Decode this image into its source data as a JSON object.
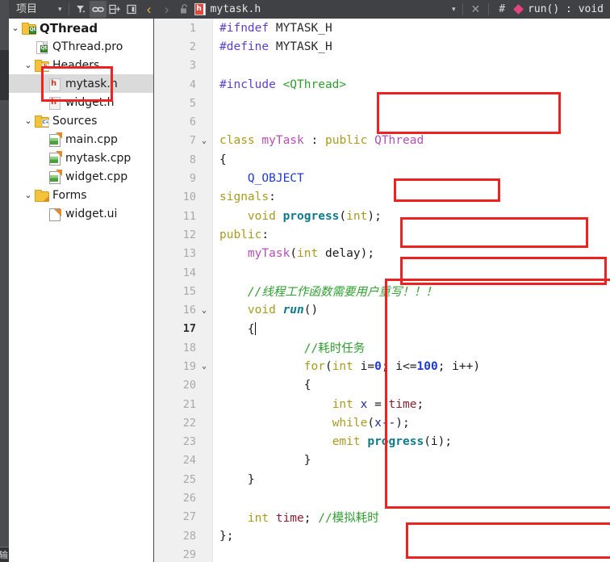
{
  "toolbar": {
    "project_label": "项目",
    "dropdown_caret": "▾",
    "filter_icon": "filter-icon",
    "link_icon": "link-icon",
    "split_icon": "split-add-icon",
    "panel_icon": "panel-icon",
    "nav_back": "‹",
    "nav_forward": "›",
    "lock_icon": "unlock-icon",
    "file_badge": "h",
    "filename": "mytask.h",
    "tab_caret": "▾",
    "close_label": "✕",
    "hash_label": "#",
    "symbol_label": "run() : void"
  },
  "rail": {
    "bottom_label": "输"
  },
  "sidebar": {
    "tree": [
      {
        "label": "QThread",
        "indent": 0,
        "chevron": "⌄",
        "icon": "folder-qt-icon",
        "bold": true,
        "selected": false
      },
      {
        "label": "QThread.pro",
        "indent": 1,
        "chevron": "",
        "icon": "doc-qt-icon",
        "bold": false,
        "selected": false
      },
      {
        "label": "Headers",
        "indent": 1,
        "chevron": "⌄",
        "icon": "folder-h-icon",
        "bold": false,
        "selected": false
      },
      {
        "label": "mytask.h",
        "indent": 2,
        "chevron": "",
        "icon": "h-file-icon",
        "bold": false,
        "selected": true
      },
      {
        "label": "widget.h",
        "indent": 2,
        "chevron": "",
        "icon": "h-file-icon",
        "bold": false,
        "selected": false
      },
      {
        "label": "Sources",
        "indent": 1,
        "chevron": "⌄",
        "icon": "folder-cpp-icon",
        "bold": false,
        "selected": false
      },
      {
        "label": "main.cpp",
        "indent": 2,
        "chevron": "",
        "icon": "cpp-file-icon",
        "bold": false,
        "selected": false
      },
      {
        "label": "mytask.cpp",
        "indent": 2,
        "chevron": "",
        "icon": "cpp-file-icon",
        "bold": false,
        "selected": false
      },
      {
        "label": "widget.cpp",
        "indent": 2,
        "chevron": "",
        "icon": "cpp-file-icon",
        "bold": false,
        "selected": false
      },
      {
        "label": "Forms",
        "indent": 1,
        "chevron": "⌄",
        "icon": "folder-ui-icon",
        "bold": false,
        "selected": false
      },
      {
        "label": "widget.ui",
        "indent": 2,
        "chevron": "",
        "icon": "ui-file-icon",
        "bold": false,
        "selected": false
      }
    ]
  },
  "editor": {
    "current_line": 17,
    "lines": [
      {
        "n": "1",
        "fold": "",
        "tokens": [
          {
            "t": "#ifndef ",
            "c": "t-pre"
          },
          {
            "t": "MYTASK_H",
            "c": "t-macro"
          }
        ]
      },
      {
        "n": "2",
        "fold": "",
        "tokens": [
          {
            "t": "#define ",
            "c": "t-pre"
          },
          {
            "t": "MYTASK_H",
            "c": "t-macro"
          }
        ]
      },
      {
        "n": "3",
        "fold": "",
        "tokens": []
      },
      {
        "n": "4",
        "fold": "",
        "tokens": [
          {
            "t": "#include ",
            "c": "t-pre"
          },
          {
            "t": "<QThread>",
            "c": "t-str"
          }
        ]
      },
      {
        "n": "5",
        "fold": "",
        "tokens": []
      },
      {
        "n": "6",
        "fold": "",
        "tokens": []
      },
      {
        "n": "7",
        "fold": "⌄",
        "tokens": [
          {
            "t": "class ",
            "c": "t-kw"
          },
          {
            "t": "myTask",
            "c": "t-type"
          },
          {
            "t": " : ",
            "c": "t-plain"
          },
          {
            "t": "public ",
            "c": "t-kw"
          },
          {
            "t": "QThread",
            "c": "t-type"
          }
        ]
      },
      {
        "n": "8",
        "fold": "",
        "tokens": [
          {
            "t": "{",
            "c": "t-plain"
          }
        ]
      },
      {
        "n": "9",
        "fold": "",
        "tokens": [
          {
            "t": "    ",
            "c": "t-plain"
          },
          {
            "t": "Q_OBJECT",
            "c": "t-obj"
          }
        ]
      },
      {
        "n": "10",
        "fold": "",
        "tokens": [
          {
            "t": "signals",
            "c": "t-kw"
          },
          {
            "t": ":",
            "c": "t-plain"
          }
        ]
      },
      {
        "n": "11",
        "fold": "",
        "tokens": [
          {
            "t": "    ",
            "c": "t-plain"
          },
          {
            "t": "void ",
            "c": "t-kw"
          },
          {
            "t": "progress",
            "c": "t-fn"
          },
          {
            "t": "(",
            "c": "t-plain"
          },
          {
            "t": "int",
            "c": "t-kw"
          },
          {
            "t": ");",
            "c": "t-plain"
          }
        ]
      },
      {
        "n": "12",
        "fold": "",
        "tokens": [
          {
            "t": "public",
            "c": "t-kw"
          },
          {
            "t": ":",
            "c": "t-plain"
          }
        ]
      },
      {
        "n": "13",
        "fold": "",
        "tokens": [
          {
            "t": "    ",
            "c": "t-plain"
          },
          {
            "t": "myTask",
            "c": "t-type"
          },
          {
            "t": "(",
            "c": "t-plain"
          },
          {
            "t": "int ",
            "c": "t-kw"
          },
          {
            "t": "delay",
            "c": "t-plain"
          },
          {
            "t": ");",
            "c": "t-plain"
          }
        ]
      },
      {
        "n": "14",
        "fold": "",
        "tokens": []
      },
      {
        "n": "15",
        "fold": "",
        "tokens": [
          {
            "t": "    ",
            "c": "t-plain"
          },
          {
            "t": "//线程工作函数需要用户重写！！！",
            "c": "t-cmt"
          }
        ]
      },
      {
        "n": "16",
        "fold": "⌄",
        "tokens": [
          {
            "t": "    ",
            "c": "t-plain"
          },
          {
            "t": "void ",
            "c": "t-kw"
          },
          {
            "t": "run",
            "c": "t-fni"
          },
          {
            "t": "()",
            "c": "t-plain"
          }
        ]
      },
      {
        "n": "17",
        "fold": "",
        "tokens": [
          {
            "t": "    ",
            "c": "t-plain"
          },
          {
            "t": "{",
            "c": "t-plain"
          }
        ],
        "caret": true
      },
      {
        "n": "18",
        "fold": "",
        "tokens": [
          {
            "t": "            ",
            "c": "t-plain"
          },
          {
            "t": "//耗时任务",
            "c": "t-cmt2"
          }
        ]
      },
      {
        "n": "19",
        "fold": "⌄",
        "tokens": [
          {
            "t": "            ",
            "c": "t-plain"
          },
          {
            "t": "for",
            "c": "t-kw"
          },
          {
            "t": "(",
            "c": "t-plain"
          },
          {
            "t": "int ",
            "c": "t-kw"
          },
          {
            "t": "i",
            "c": "t-plain"
          },
          {
            "t": "=",
            "c": "t-plain"
          },
          {
            "t": "0",
            "c": "t-num"
          },
          {
            "t": "; i",
            "c": "t-plain"
          },
          {
            "t": "<=",
            "c": "t-plain"
          },
          {
            "t": "100",
            "c": "t-num"
          },
          {
            "t": "; i",
            "c": "t-plain"
          },
          {
            "t": "++)",
            "c": "t-plain"
          }
        ]
      },
      {
        "n": "20",
        "fold": "",
        "tokens": [
          {
            "t": "            ",
            "c": "t-plain"
          },
          {
            "t": "{",
            "c": "t-plain"
          }
        ]
      },
      {
        "n": "21",
        "fold": "",
        "tokens": [
          {
            "t": "                ",
            "c": "t-plain"
          },
          {
            "t": "int ",
            "c": "t-kw"
          },
          {
            "t": "x",
            "c": "t-var"
          },
          {
            "t": " = ",
            "c": "t-plain"
          },
          {
            "t": "time",
            "c": "t-field"
          },
          {
            "t": ";",
            "c": "t-plain"
          }
        ]
      },
      {
        "n": "22",
        "fold": "",
        "tokens": [
          {
            "t": "                ",
            "c": "t-plain"
          },
          {
            "t": "while",
            "c": "t-kw"
          },
          {
            "t": "(",
            "c": "t-plain"
          },
          {
            "t": "x",
            "c": "t-var"
          },
          {
            "t": "--);",
            "c": "t-plain"
          }
        ]
      },
      {
        "n": "23",
        "fold": "",
        "tokens": [
          {
            "t": "                ",
            "c": "t-plain"
          },
          {
            "t": "emit ",
            "c": "t-kw"
          },
          {
            "t": "progress",
            "c": "t-fn"
          },
          {
            "t": "(i);",
            "c": "t-plain"
          }
        ]
      },
      {
        "n": "24",
        "fold": "",
        "tokens": [
          {
            "t": "            ",
            "c": "t-plain"
          },
          {
            "t": "}",
            "c": "t-plain"
          }
        ]
      },
      {
        "n": "25",
        "fold": "",
        "tokens": [
          {
            "t": "    ",
            "c": "t-plain"
          },
          {
            "t": "}",
            "c": "t-plain"
          }
        ]
      },
      {
        "n": "26",
        "fold": "",
        "tokens": []
      },
      {
        "n": "27",
        "fold": "",
        "tokens": [
          {
            "t": "    ",
            "c": "t-plain"
          },
          {
            "t": "int ",
            "c": "t-kw"
          },
          {
            "t": "time",
            "c": "t-field"
          },
          {
            "t": "; ",
            "c": "t-plain"
          },
          {
            "t": "//模拟耗时",
            "c": "t-cmt2"
          }
        ]
      },
      {
        "n": "28",
        "fold": "",
        "tokens": [
          {
            "t": "};",
            "c": "t-plain"
          }
        ]
      },
      {
        "n": "29",
        "fold": "",
        "tokens": []
      }
    ]
  },
  "annotations": {
    "color": "#ef2222",
    "boxes": [
      "headers-group-box",
      "include-qthread-box",
      "q-object-box",
      "progress-signal-box",
      "mytask-ctor-box",
      "run-body-box",
      "time-member-box"
    ]
  }
}
